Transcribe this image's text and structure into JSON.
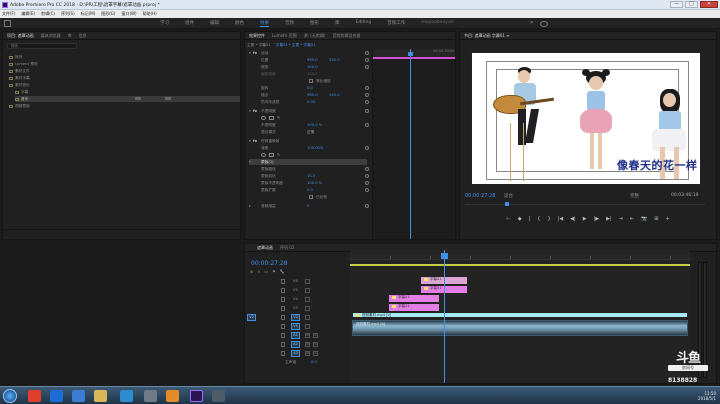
{
  "window": {
    "title": "Adobe Premiere Pro CC 2018 - D:\\PR\\工程\\遮罩字幕\\遮罩动画.prproj *",
    "minimize": "—",
    "maximize": "□",
    "close": "✕"
  },
  "menu": [
    "文件(F)",
    "编辑(E)",
    "剪辑(C)",
    "序列(S)",
    "标记(M)",
    "图形(G)",
    "窗口(W)",
    "帮助(H)"
  ],
  "workspaces": {
    "items": [
      "学习",
      "组件",
      "编辑",
      "颜色",
      "效果",
      "音频",
      "图形",
      "库",
      "Editing",
      "音频工作",
      "Hapjoobaoyan"
    ],
    "active_index": 4,
    "more": "»"
  },
  "project_panel": {
    "tabs": [
      "项目: 遮罩动画",
      "媒体浏览器",
      "库",
      "信息"
    ],
    "active_tab": 0,
    "search_placeholder": "搜索",
    "items": [
      {
        "label": "序列"
      },
      {
        "label": "Lumetri 预设"
      },
      {
        "label": "素材文件"
      },
      {
        "label": "素材字幕"
      },
      {
        "label": "素材音乐"
      },
      {
        "label": "字幕"
      },
      {
        "label": "音乐"
      },
      {
        "label": "视频蒙版"
      }
    ],
    "selected_index": 6
  },
  "effect_controls": {
    "tabs": [
      "效果控件",
      "Lumetri 范围",
      "源: (无剪辑)",
      "音频剪辑混合器"
    ],
    "active_tab": 0,
    "source_label": "主要 * 字幕01",
    "sequence_label": "字幕01 * 主要 * 字幕01",
    "rows": [
      {
        "kind": "section",
        "label": "运动"
      },
      {
        "kind": "prop",
        "label": "位置",
        "v1": "960.0",
        "v2": "540.0"
      },
      {
        "kind": "prop",
        "label": "缩放",
        "v1": "100.0"
      },
      {
        "kind": "prop",
        "label": "缩放宽度",
        "v1": "100.0"
      },
      {
        "kind": "check",
        "label": "等比缩放"
      },
      {
        "kind": "prop",
        "label": "旋转",
        "v1": "0.0"
      },
      {
        "kind": "prop",
        "label": "锚点",
        "v1": "960.0",
        "v2": "540.0"
      },
      {
        "kind": "prop",
        "label": "防闪烁滤镜",
        "v1": "0.00"
      },
      {
        "kind": "section",
        "label": "不透明度"
      },
      {
        "kind": "masks"
      },
      {
        "kind": "prop",
        "label": "不透明度",
        "v1": "100.0 %"
      },
      {
        "kind": "prop",
        "label": "混合模式",
        "v1": "正常"
      },
      {
        "kind": "section",
        "label": "时间重映射"
      },
      {
        "kind": "prop",
        "label": "速度",
        "v1": "100.00%"
      },
      {
        "kind": "masks"
      },
      {
        "kind": "highlight",
        "label": "蒙版(1)"
      },
      {
        "kind": "prop",
        "label": "蒙版路径",
        "v1": ""
      },
      {
        "kind": "prop",
        "label": "蒙版羽化",
        "v1": "10.0"
      },
      {
        "kind": "prop",
        "label": "蒙版不透明度",
        "v1": "100.0 %"
      },
      {
        "kind": "prop",
        "label": "蒙版扩展",
        "v1": "0.0"
      },
      {
        "kind": "check",
        "label": "已反转"
      },
      {
        "kind": "prop",
        "label": "音频增益",
        "v1": "0"
      }
    ],
    "ruler_label": "00:00:30:00"
  },
  "program_monitor": {
    "title": "节目: 遮罩动画 字幕01 ≡",
    "subtitle": "像春天的花一样",
    "timecode": "00:00:27:28",
    "fit": "适合",
    "quality": "完整",
    "duration": "00:03:46:19",
    "controls": [
      "⊢",
      "◆",
      "|",
      "{",
      "}",
      "|◀",
      "◀|",
      "▶",
      "|▶",
      "▶|",
      "⇥",
      "⇤",
      "📷",
      "⊞",
      "+"
    ]
  },
  "timeline": {
    "tabs": [
      "遮罩动画",
      "序列 02"
    ],
    "timecode": "00:00:27:28",
    "tools": [
      "⊕",
      "∩",
      "▭",
      "⚑",
      "🔧"
    ],
    "tracks": [
      {
        "name": "V6",
        "tgt": "V6"
      },
      {
        "name": "V5",
        "tgt": "V5"
      },
      {
        "name": "V4",
        "tgt": "V4"
      },
      {
        "name": "V3",
        "tgt": "V3"
      },
      {
        "name": "V2",
        "tgt": "V2"
      },
      {
        "name": "V1",
        "tgt": "V1"
      },
      {
        "name": "A1",
        "tgt": "A1"
      },
      {
        "name": "A2",
        "tgt": "A2"
      },
      {
        "name": "A3",
        "tgt": "A3"
      },
      {
        "name": "主声道",
        "tgt": "0.0"
      }
    ],
    "clips": [
      {
        "label": "字幕01",
        "row": 0
      },
      {
        "label": "字幕01",
        "row": 1
      },
      {
        "label": "字幕01",
        "row": 2
      },
      {
        "label": "字幕01",
        "row": 3
      },
      {
        "label": "视频素材.mp4 [V]",
        "row": 4
      },
      {
        "label": "视频素材.mp4 [A]",
        "row": 5
      }
    ]
  },
  "watermark": {
    "logo": "斗鱼",
    "sub": "房间号",
    "room_id": "8138828"
  },
  "taskbar": {
    "time": "11:50",
    "date": "2018/5/1"
  }
}
